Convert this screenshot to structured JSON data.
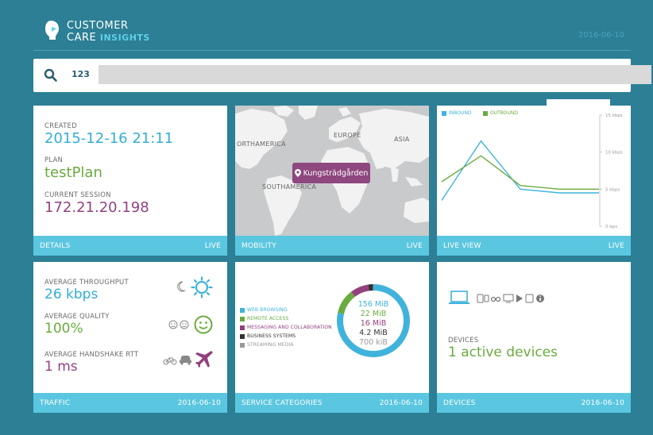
{
  "header": {
    "brand_line1": "CUSTOMER",
    "brand_line2_a": "CARE",
    "brand_line2_b": "INSIGHTS",
    "date": "2016-06-10"
  },
  "search": {
    "value": "123"
  },
  "details": {
    "created_label": "CREATED",
    "created_value": "2015-12-16 21:11",
    "plan_label": "PLAN",
    "plan_value": "testPlan",
    "session_label": "CURRENT SESSION",
    "session_value": "172.21.20.198",
    "footer_left": "DETAILS",
    "footer_right": "LIVE"
  },
  "mobility": {
    "map_labels": [
      "ORTHAMERICA",
      "EUROPE",
      "ASIA",
      "SOUTHAMERICA"
    ],
    "pin_label": "Kungsträdgården",
    "footer_left": "MOBILITY",
    "footer_right": "LIVE"
  },
  "live_view": {
    "legend_inbound": "INBOUND",
    "legend_outbound": "OUTBOUND",
    "footer_left": "LIVE VIEW",
    "footer_right": "LIVE",
    "colors": {
      "inbound": "#3fb3dc",
      "outbound": "#6aab3f"
    }
  },
  "chart_data": {
    "type": "line",
    "x": [
      0,
      1,
      2,
      3,
      4
    ],
    "series": [
      {
        "name": "INBOUND",
        "values": [
          3.5,
          11.5,
          5.0,
          4.5,
          4.5
        ]
      },
      {
        "name": "OUTBOUND",
        "values": [
          6.0,
          9.5,
          5.5,
          5.0,
          5.0
        ]
      }
    ],
    "yticks": [
      "0 bps",
      "5 kbps",
      "10 kbps",
      "15 kbps"
    ],
    "ytick_values": [
      0,
      5,
      10,
      15
    ],
    "ylim": [
      0,
      15
    ]
  },
  "traffic": {
    "throughput_label": "AVERAGE THROUGHPUT",
    "throughput_value": "26 kbps",
    "quality_label": "AVERAGE QUALITY",
    "quality_value": "100%",
    "rtt_label": "AVERAGE HANDSHAKE RTT",
    "rtt_value": "1 ms",
    "footer_left": "TRAFFIC",
    "footer_right": "2016-06-10"
  },
  "service": {
    "categories": [
      {
        "label": "WEB BROWSING",
        "value": "156 MiB",
        "color": "#3fb3dc"
      },
      {
        "label": "REMOTE ACCESS",
        "value": "22 MiB",
        "color": "#6aab3f"
      },
      {
        "label": "MESSAGING AND COLLABORATION",
        "value": "16 MiB",
        "color": "#94407f"
      },
      {
        "label": "BUSINESS SYSTEMS",
        "value": "4.2 MiB",
        "color": "#333333"
      },
      {
        "label": "STREAMING MEDIA",
        "value": "700 kiB",
        "color": "#999999"
      }
    ],
    "footer_left": "SERVICE CATEGORIES",
    "footer_right": "2016-06-10"
  },
  "devices": {
    "label": "DEVICES",
    "value": "1 active devices",
    "footer_left": "DEVICES",
    "footer_right": "2016-06-10"
  }
}
